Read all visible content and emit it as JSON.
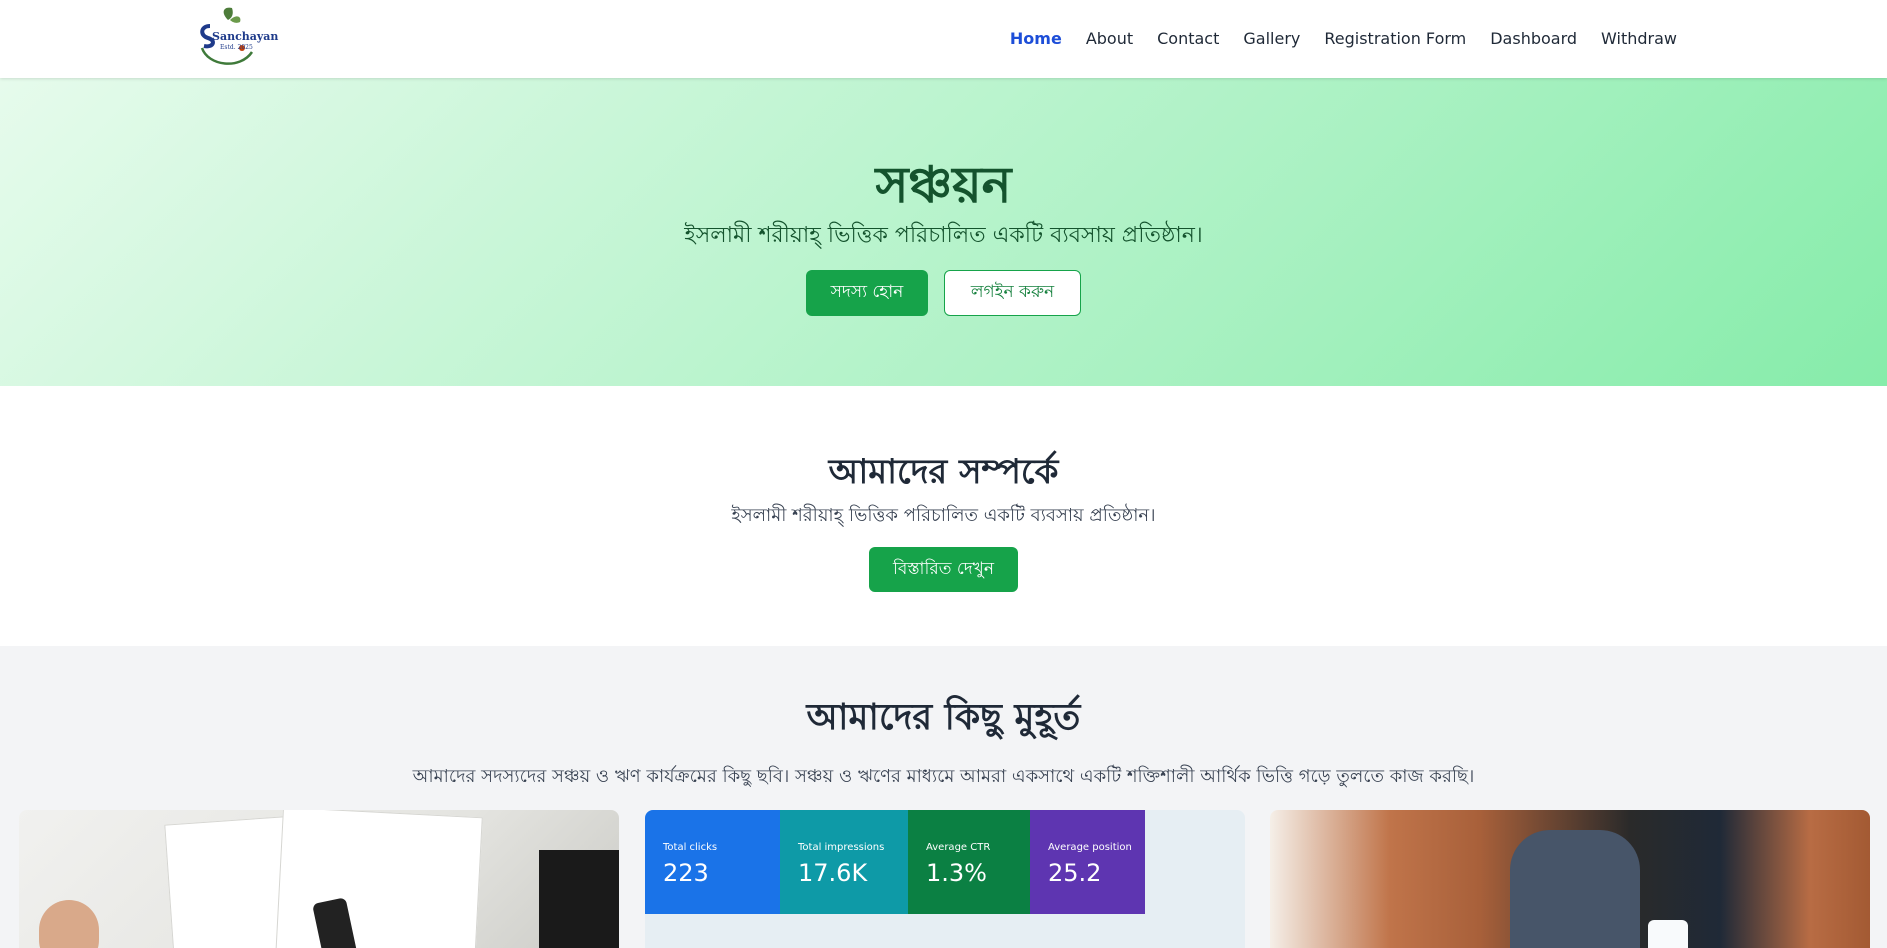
{
  "brand": {
    "logo_text": "Sanchayan",
    "logo_est": "Estd. 2025"
  },
  "nav": [
    {
      "label": "Home",
      "active": true
    },
    {
      "label": "About"
    },
    {
      "label": "Contact"
    },
    {
      "label": "Gallery"
    },
    {
      "label": "Registration Form"
    },
    {
      "label": "Dashboard"
    },
    {
      "label": "Withdraw"
    }
  ],
  "hero": {
    "title": "সঞ্চয়ন",
    "subtitle": "ইসলামী শরীয়াহ্ ভিত্তিক পরিচালিত একটি ব্যবসায় প্রতিষ্ঠান।",
    "primary_button": "সদস্য হোন",
    "secondary_button": "লগইন করুন"
  },
  "about": {
    "title": "আমাদের সম্পর্কে",
    "text": "ইসলামী শরীয়াহ্ ভিত্তিক পরিচালিত একটি ব্যবসায় প্রতিষ্ঠান।",
    "button": "বিস্তারিত দেখুন"
  },
  "gallery": {
    "title": "আমাদের কিছু মুহূর্ত",
    "text": "আমাদের সদস্যদের সঞ্চয় ও ঋণ কার্যক্রমের কিছু ছবি। সঞ্চয় ও ঋণের মাধ্যমে আমরা একসাথে একটি শক্তিশালী আর্থিক ভিত্তি গড়ে তুলতে কাজ করছি।",
    "stats": [
      {
        "label": "Total clicks",
        "value": "223",
        "color": "#1a73e8"
      },
      {
        "label": "Total impressions",
        "value": "17.6K",
        "color": "#0e9aa7"
      },
      {
        "label": "Average CTR",
        "value": "1.3%",
        "color": "#0b8043"
      },
      {
        "label": "Average position",
        "value": "25.2",
        "color": "#5e35b1"
      }
    ]
  },
  "colors": {
    "accent": "#16a34a",
    "nav_active": "#1d4ed8",
    "hero_text": "#14532d"
  }
}
